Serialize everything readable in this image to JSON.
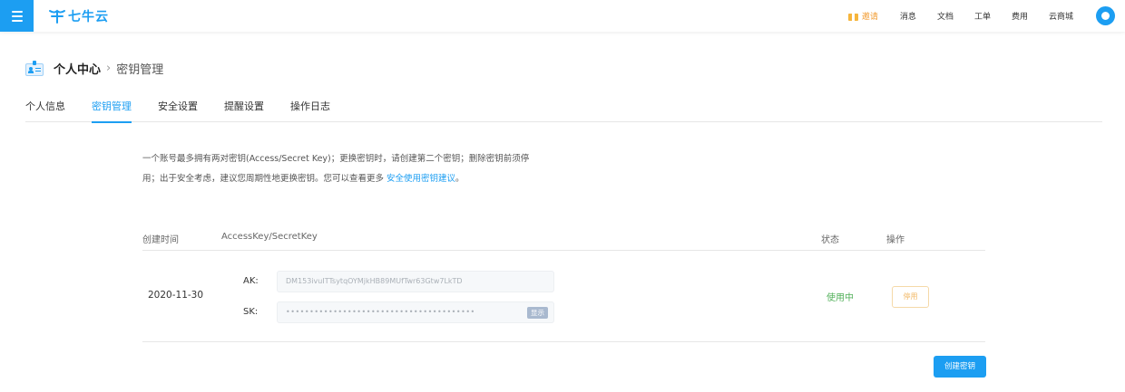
{
  "header": {
    "logo_text": "七牛云",
    "invite_label": "邀请",
    "nav": [
      "消息",
      "文档",
      "工单",
      "费用",
      "云商城"
    ],
    "accent_color": "#1c9ef2"
  },
  "breadcrumb": {
    "root": "个人中心",
    "separator": "›",
    "current": "密钥管理"
  },
  "tabs": [
    {
      "label": "个人信息",
      "active": false
    },
    {
      "label": "密钥管理",
      "active": true
    },
    {
      "label": "安全设置",
      "active": false
    },
    {
      "label": "提醒设置",
      "active": false
    },
    {
      "label": "操作日志",
      "active": false
    }
  ],
  "description": {
    "text_line1": "一个账号最多拥有两对密钥(Access/Secret Key)；更换密钥时，请创建第二个密钥；删除密钥前须停",
    "text_line2": "用；出于安全考虑，建议您周期性地更换密钥。您可以查看更多 ",
    "link": "安全使用密钥建议",
    "tail": "。"
  },
  "table": {
    "headers": {
      "date": "创建时间",
      "keys": "AccessKey/SecretKey",
      "status": "状态",
      "op": "操作"
    },
    "rows": [
      {
        "date": "2020-11-30",
        "ak_label": "AK:",
        "ak_value": "DM153ivuITTsytqOYMjkHB89MUfTwr63Gtw7LkTD",
        "sk_label": "SK:",
        "sk_value": "••••••••••••••••••••••••••••••••••••••••",
        "show_label": "显示",
        "status": "使用中",
        "action": "停用"
      }
    ]
  },
  "create_button": "创建密钥"
}
